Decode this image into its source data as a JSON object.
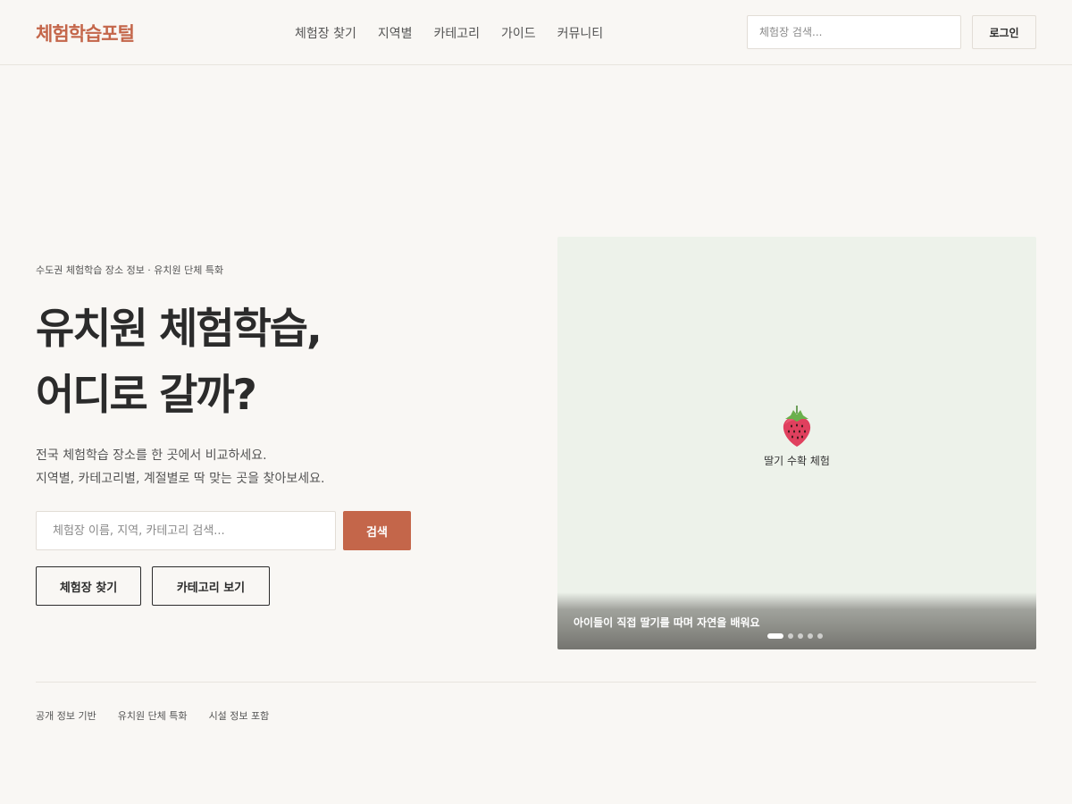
{
  "header": {
    "logo": "체험학습포털",
    "nav": [
      "체험장 찾기",
      "지역별",
      "카테고리",
      "가이드",
      "커뮤니티"
    ],
    "search_placeholder": "체험장 검색...",
    "login_label": "로그인"
  },
  "hero": {
    "eyebrow": "수도권 체험학습 장소 정보 · 유치원 단체 특화",
    "title_line1": "유치원 체험학습,",
    "title_line2": "어디로 갈까?",
    "desc_line1": "전국 체험학습 장소를 한 곳에서 비교하세요.",
    "desc_line2": "지역별, 카테고리별, 계절별로 딱 맞는 곳을 찾아보세요.",
    "search_placeholder": "체험장 이름, 지역, 카테고리 검색...",
    "search_button": "검색",
    "find_button": "체험장 찾기",
    "category_button": "카테고리 보기"
  },
  "slider": {
    "icon": "strawberry-icon",
    "label": "딸기 수확 체험",
    "caption": "아이들이 직접 딸기를 따며 자연을 배워요",
    "slide_count": 5,
    "active_index": 0
  },
  "features": [
    "공개 정보 기반",
    "유치원 단체 특화",
    "시설 정보 포함"
  ],
  "colors": {
    "accent": "#c4664a",
    "background": "#f9f7f4",
    "slide_background": "#edf2ea",
    "text": "#2b2b2b"
  }
}
